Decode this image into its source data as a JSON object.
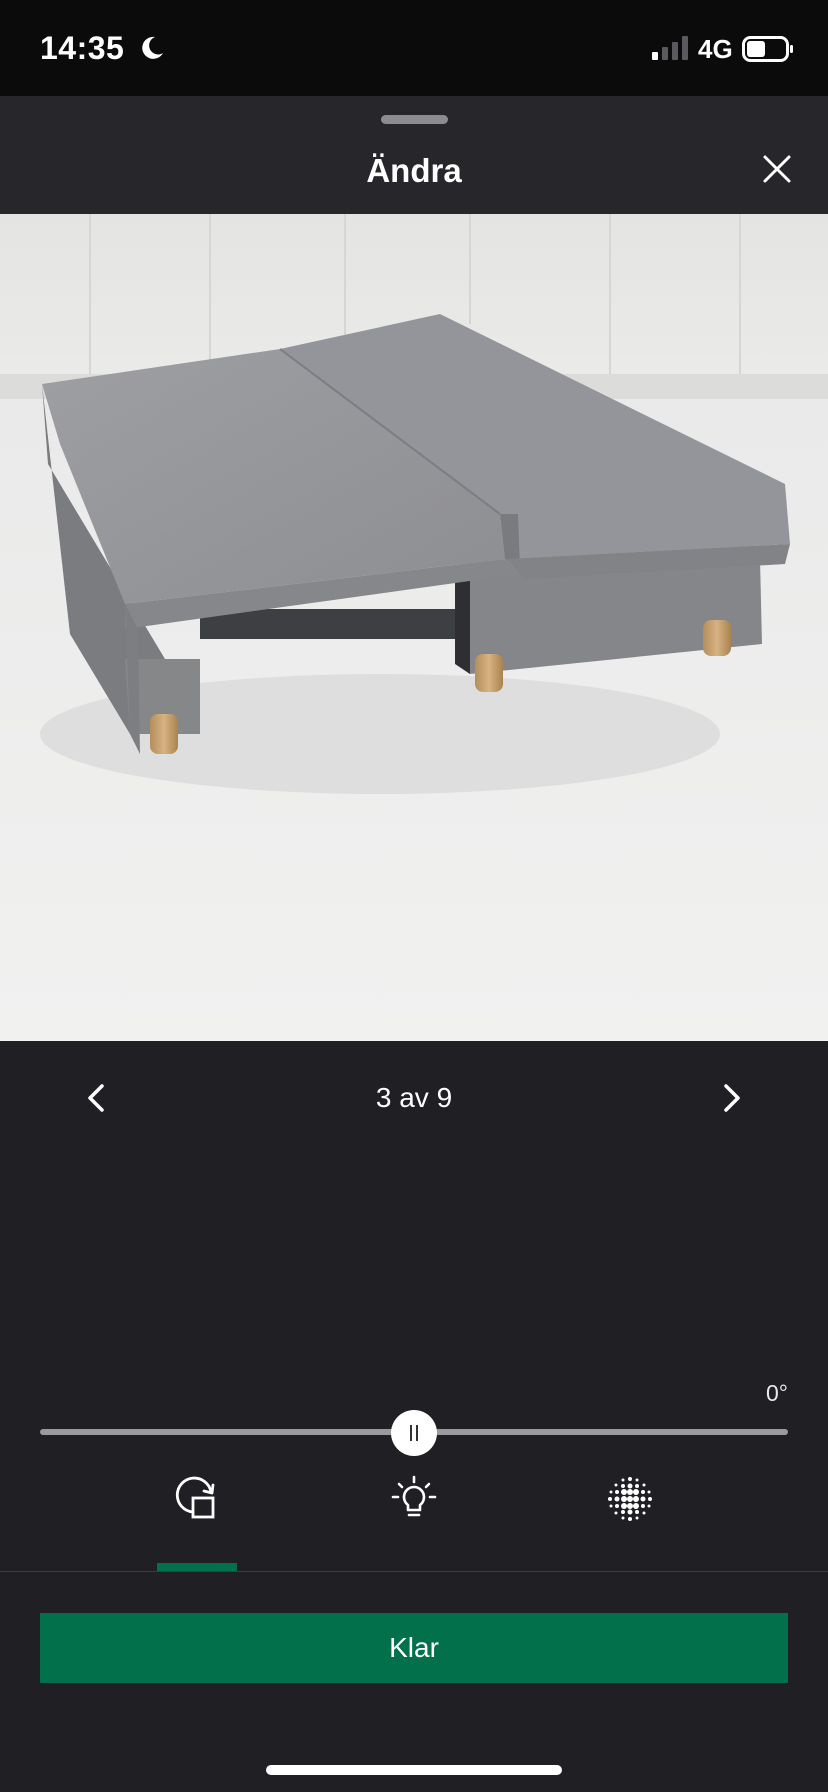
{
  "status_bar": {
    "time": "14:35",
    "network": "4G",
    "icons": [
      "moon-icon",
      "cellular-signal-icon",
      "battery-icon"
    ]
  },
  "header": {
    "title": "Ändra",
    "close_icon": "close-icon"
  },
  "image": {
    "alt": "Grå bäddsoffa utdragen till säng"
  },
  "pager": {
    "counter": "3 av 9",
    "prev_icon": "chevron-left-icon",
    "next_icon": "chevron-right-icon"
  },
  "rotation": {
    "angle_label": "0°",
    "value_degrees": 0,
    "slider_position": 0.5
  },
  "tools": [
    {
      "name": "rotate",
      "icon": "rotate-crop-icon",
      "selected": true
    },
    {
      "name": "brightness",
      "icon": "lightbulb-icon",
      "selected": false
    },
    {
      "name": "filter",
      "icon": "dots-grid-icon",
      "selected": false
    }
  ],
  "actions": {
    "done_label": "Klar"
  },
  "colors": {
    "accent": "#02704a",
    "background": "#1f1f24",
    "header": "#26262b",
    "status_bar": "#0b0b0c"
  }
}
